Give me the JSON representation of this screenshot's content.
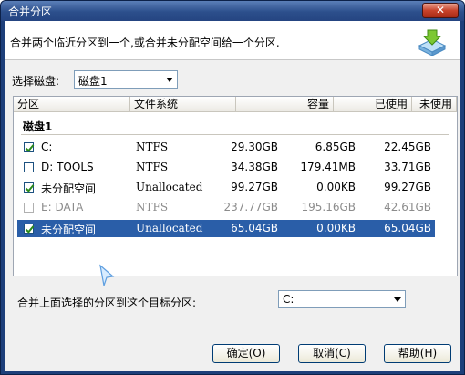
{
  "window": {
    "title": "合并分区",
    "close_glyph": "✕"
  },
  "header": {
    "description": "合并两个临近分区到一个,或合并未分配空间给一个分区."
  },
  "disk_select": {
    "label": "选择磁盘:",
    "value": "磁盘1"
  },
  "table": {
    "columns": [
      "分区",
      "文件系统",
      "容量",
      "已使用",
      "未使用"
    ],
    "group": "磁盘1",
    "rows": [
      {
        "checked": true,
        "name": "C:",
        "fs": "NTFS",
        "capacity": "29.30GB",
        "used": "6.85GB",
        "free": "22.45GB",
        "state": "normal"
      },
      {
        "checked": false,
        "name": "D: TOOLS",
        "fs": "NTFS",
        "capacity": "34.38GB",
        "used": "179.41MB",
        "free": "33.71GB",
        "state": "normal"
      },
      {
        "checked": true,
        "name": "未分配空间",
        "fs": "Unallocated",
        "capacity": "99.27GB",
        "used": "0.00KB",
        "free": "99.27GB",
        "state": "normal"
      },
      {
        "checked": false,
        "name": "E: DATA",
        "fs": "NTFS",
        "capacity": "237.77GB",
        "used": "195.16GB",
        "free": "42.61GB",
        "state": "disabled"
      },
      {
        "checked": true,
        "name": "未分配空间",
        "fs": "Unallocated",
        "capacity": "65.04GB",
        "used": "0.00KB",
        "free": "65.04GB",
        "state": "selected"
      }
    ]
  },
  "target": {
    "label": "合并上面选择的分区到这个目标分区:",
    "value": "C:"
  },
  "buttons": {
    "ok": "确定(O)",
    "cancel": "取消(C)",
    "help": "帮助(H)"
  }
}
